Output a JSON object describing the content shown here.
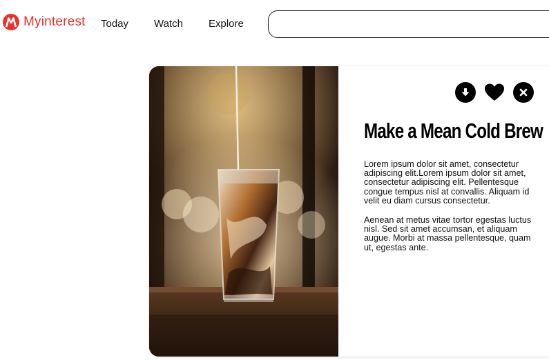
{
  "brand": {
    "name": "Myinterest",
    "color": "#e8322c",
    "logo_icon": "m-logo-icon"
  },
  "nav": [
    {
      "label": "Today"
    },
    {
      "label": "Watch"
    },
    {
      "label": "Explore"
    }
  ],
  "search": {
    "value": "",
    "placeholder": ""
  },
  "card": {
    "image": "iced-cold-brew-coffee-photo",
    "actions": [
      {
        "icon": "download-icon"
      },
      {
        "icon": "heart-icon"
      },
      {
        "icon": "close-icon"
      }
    ],
    "title": "Make a Mean Cold Brew",
    "paragraphs": [
      "Lorem ipsum dolor sit amet, consectetur adipiscing elit.Lorem ipsum dolor sit amet, consectetur adipiscing elit. Pellentesque congue tempus nisl at convallis. Aliquam id velit eu diam cursus consectetur.",
      "Aenean at metus vitae tortor egestas luctus nisl. Sed sit amet accumsan, et aliquam augue. Morbi at massa pellentesque, quam ut, egestas ante."
    ]
  }
}
